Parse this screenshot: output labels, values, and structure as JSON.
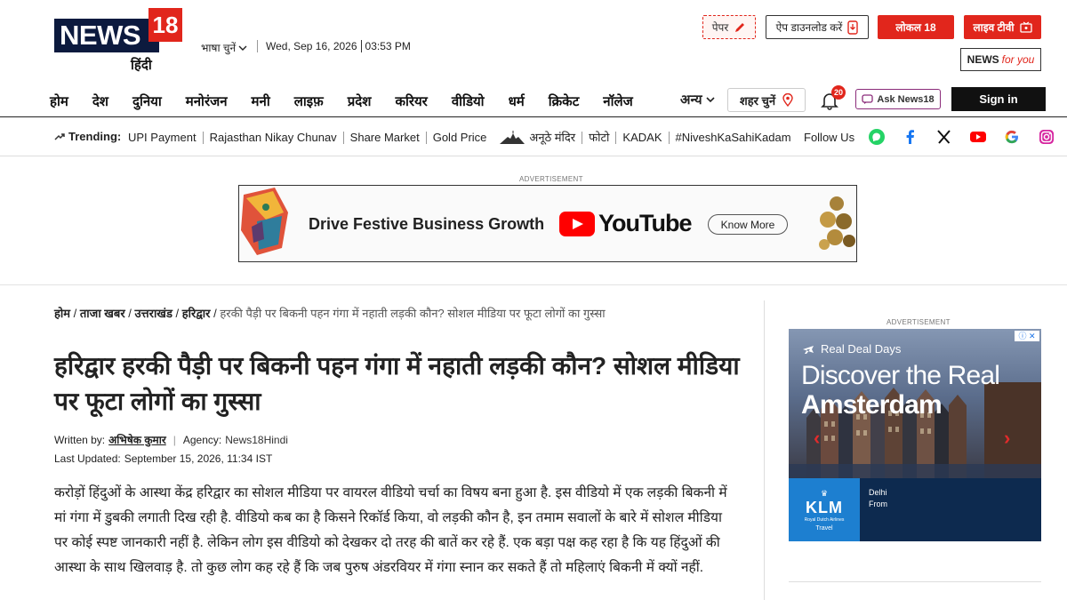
{
  "brand": {
    "news": "NEWS",
    "num": "18",
    "hindi": "हिंदी"
  },
  "header": {
    "language_select": "भाषा चुनें",
    "date": "Wed, Sep 16, 2026",
    "time": "03:53 PM",
    "paper_label": "पेपर",
    "app_download": "ऐप डाउनलोड करें",
    "local18": "लोकल 18",
    "live_tv": "लाइव टीवी",
    "news_for_you_a": "NEWS",
    "news_for_you_b": "for you"
  },
  "nav": {
    "items": [
      "होम",
      "देश",
      "दुनिया",
      "मनोरंजन",
      "मनी",
      "लाइफ़",
      "प्रदेश",
      "करियर",
      "वीडियो",
      "धर्म",
      "क्रिकेट",
      "नॉलेज"
    ],
    "more": "अन्य",
    "city": "शहर चुनें",
    "notif_count": "20",
    "ask": "Ask News18",
    "signin": "Sign in"
  },
  "trending": {
    "label": "Trending:",
    "items": [
      "UPI Payment",
      "Rajasthan Nikay Chunav",
      "Share Market",
      "Gold Price",
      "अनूठे मंदिर",
      "फोटो",
      "KADAK",
      "#NiveshKaSahiKadam"
    ],
    "follow": "Follow Us"
  },
  "top_ad": {
    "label": "ADVERTISEMENT",
    "headline": "Drive Festive Business Growth",
    "brand": "YouTube",
    "cta": "Know More"
  },
  "article": {
    "breadcrumb": [
      "होम",
      "ताजा खबर",
      "उत्तराखंड",
      "हरिद्वार"
    ],
    "breadcrumb_current": "हरकी पैड़ी पर बिकनी पहन गंगा में नहाती लड़की कौन? सोशल मीडिया पर फूटा लोगों का गुस्सा",
    "headline": "हरिद्वार हरकी पैड़ी पर बिकनी पहन गंगा में नहाती लड़की कौन? सोशल मीडिया पर फूटा लोगों का गुस्सा",
    "written_by_label": "Written by:",
    "author": "अभिषेक कुमार",
    "agency_label": "Agency:",
    "agency": "News18Hindi",
    "updated_label": "Last Updated:",
    "updated": "September 15, 2026, 11:34 IST",
    "body": "करोड़ों हिंदुओं के आस्था केंद्र हरिद्वार का सोशल मीडिया पर वायरल वीडियो चर्चा का विषय बना हुआ है. इस वीडियो में एक लड़की बिकनी में मां गंगा में डुबकी लगाती दिख रही है. वीडियो कब का है किसने रिकॉर्ड किया, वो लड़की कौन है, इन तमाम सवालों के बारे में सोशल मीडिया पर कोई स्पष्ट जानकारी नहीं है. लेकिन लोग इस वीडियो को देखकर दो तरह की बातें कर रहे हैं. एक बड़ा पक्ष कह रहा है कि यह हिंदुओं की आस्था के साथ खिलवाड़ है. तो कुछ लोग कह रहे हैं कि जब पुरुष अंडरवियर में गंगा स्नान कर सकते हैं तो महिलाएं बिकनी में क्यों नहीं."
  },
  "side_ad": {
    "label": "ADVERTISEMENT",
    "kicker": "Real Deal Days",
    "title_a": "Discover the Real",
    "title_b": "Amsterdam",
    "brand": "KLM",
    "brand_sub": "Royal Dutch Airlines",
    "travel": "Travel",
    "from_city": "Delhi",
    "from_label": "From"
  },
  "colors": {
    "brand_red": "#e1261c",
    "brand_navy": "#0c1a3e"
  }
}
